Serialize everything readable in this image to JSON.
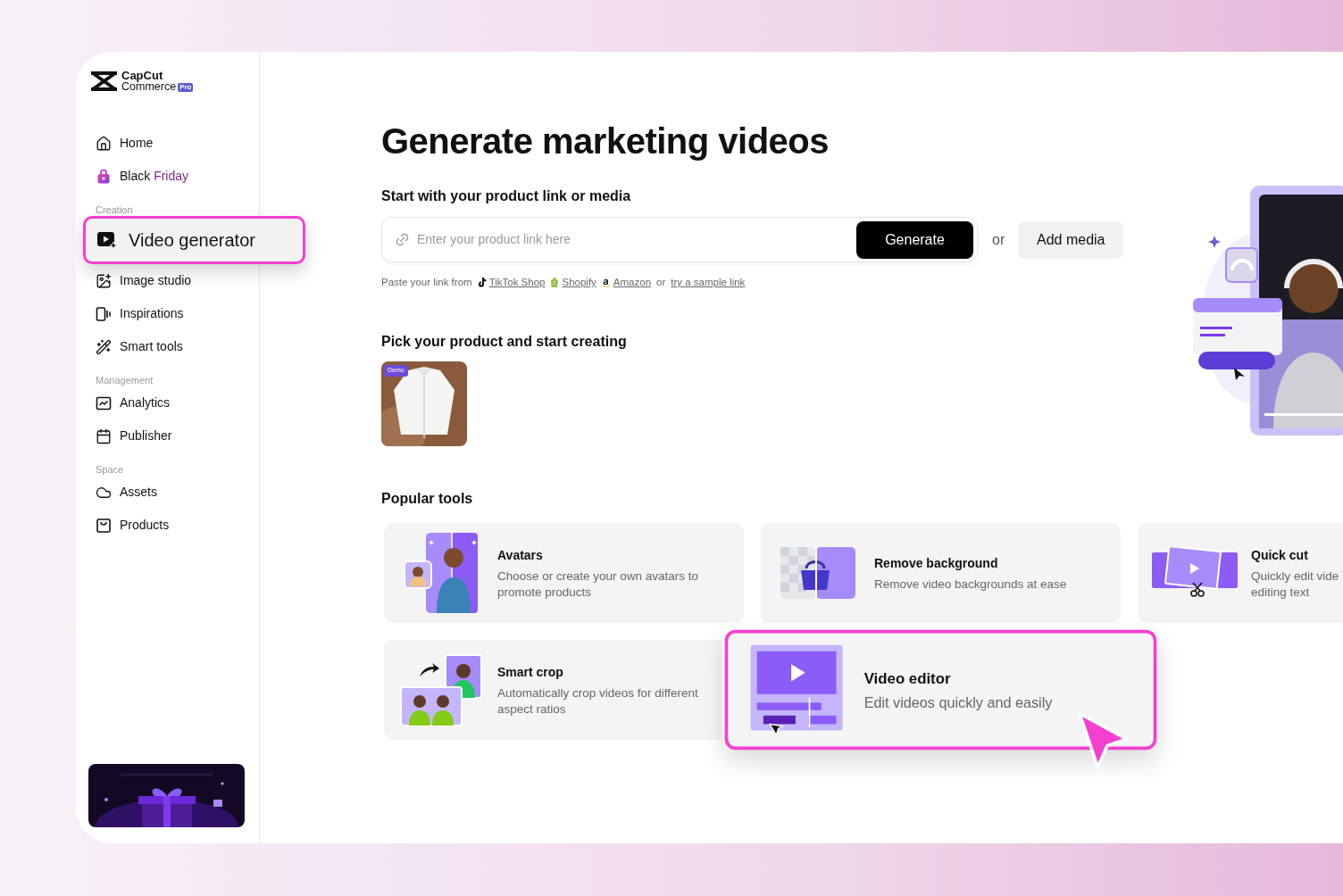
{
  "logo": {
    "name": "CapCut",
    "subtitle": "Commerce",
    "badge": "Pro"
  },
  "sidebar": {
    "sections": [
      {
        "items": [
          {
            "label": "Home",
            "selected": false
          },
          {
            "label": "Black",
            "accent": "Friday",
            "selected": false
          }
        ]
      },
      {
        "heading": "Creation",
        "items": [
          {
            "label": "Video generator",
            "selected": true
          },
          {
            "label": "Image studio",
            "selected": false
          },
          {
            "label": "Inspirations",
            "selected": false
          },
          {
            "label": "Smart tools",
            "selected": false
          }
        ]
      },
      {
        "heading": "Management",
        "items": [
          {
            "label": "Analytics",
            "selected": false
          },
          {
            "label": "Publisher",
            "selected": false
          }
        ]
      },
      {
        "heading": "Space",
        "items": [
          {
            "label": "Assets",
            "selected": false
          },
          {
            "label": "Products",
            "selected": false
          }
        ]
      }
    ]
  },
  "main": {
    "title": "Generate marketing videos",
    "link_section": {
      "heading": "Start with your product link or media",
      "input": {
        "placeholder": "Enter your product link here"
      },
      "generate_button": "Generate",
      "separator": "or",
      "add_media_button": "Add media",
      "hint": {
        "prefix": "Paste your link from",
        "sources": [
          {
            "label": "TikTok Shop"
          },
          {
            "label": "Shopify"
          },
          {
            "label": "Amazon"
          }
        ],
        "separator": "or",
        "sample_link": "try a sample link"
      }
    },
    "products": {
      "heading": "Pick your product and start creating",
      "items": [
        {
          "badge": "Demo"
        }
      ]
    },
    "tools": {
      "heading": "Popular tools",
      "items": [
        {
          "title": "Avatars",
          "description": [
            "Choose or create your own avatars to",
            "promote products"
          ],
          "highlighted": false
        },
        {
          "title": "Remove background",
          "description": [
            "Remove video backgrounds at ease"
          ],
          "highlighted": false
        },
        {
          "title": "Quick cut",
          "description": [
            "Quickly edit vide",
            "editing text"
          ],
          "highlighted": false
        },
        {
          "title": "Smart crop",
          "description": [
            "Automatically crop videos for different",
            "aspect ratios"
          ],
          "highlighted": false
        },
        {
          "title": "Video editor",
          "description": [
            "Edit videos quickly and easily"
          ],
          "highlighted": true
        }
      ]
    }
  }
}
